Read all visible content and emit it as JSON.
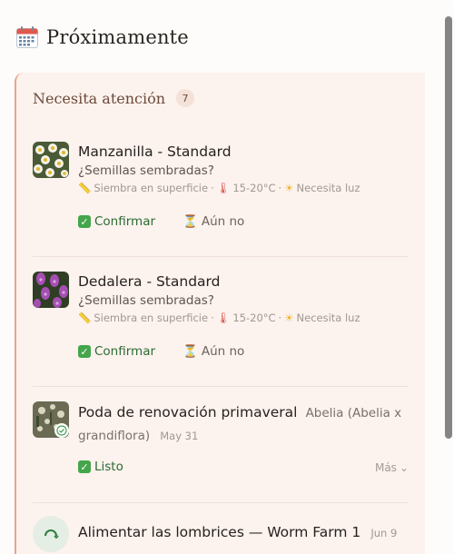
{
  "header": {
    "icon": "calendar-icon",
    "title": "Próximamente"
  },
  "panel": {
    "title": "Necesita atención",
    "count": "7",
    "accent": "#e7a58a"
  },
  "cards": [
    {
      "title": "Manzanilla - Standard",
      "question": "¿Semillas sembradas?",
      "meta": {
        "sow": "Siembra en superficie",
        "temp": "15-20°C",
        "light": "Necesita luz",
        "sep": "·"
      },
      "confirm": "Confirmar",
      "not_yet": "Aún no"
    },
    {
      "title": "Dedalera - Standard",
      "question": "¿Semillas sembradas?",
      "meta": {
        "sow": "Siembra en superficie",
        "temp": "15-20°C",
        "light": "Necesita luz",
        "sep": "·"
      },
      "confirm": "Confirmar",
      "not_yet": "Aún no"
    }
  ],
  "tasks": [
    {
      "title": "Poda de renovación primaveral",
      "plant": "Abelia (Abelia x grandiflora)",
      "date": "May 31",
      "done": "Listo",
      "more": "Más"
    },
    {
      "title": "Alimentar las lombrices — Worm Farm 1",
      "date": "Jun 9"
    }
  ]
}
